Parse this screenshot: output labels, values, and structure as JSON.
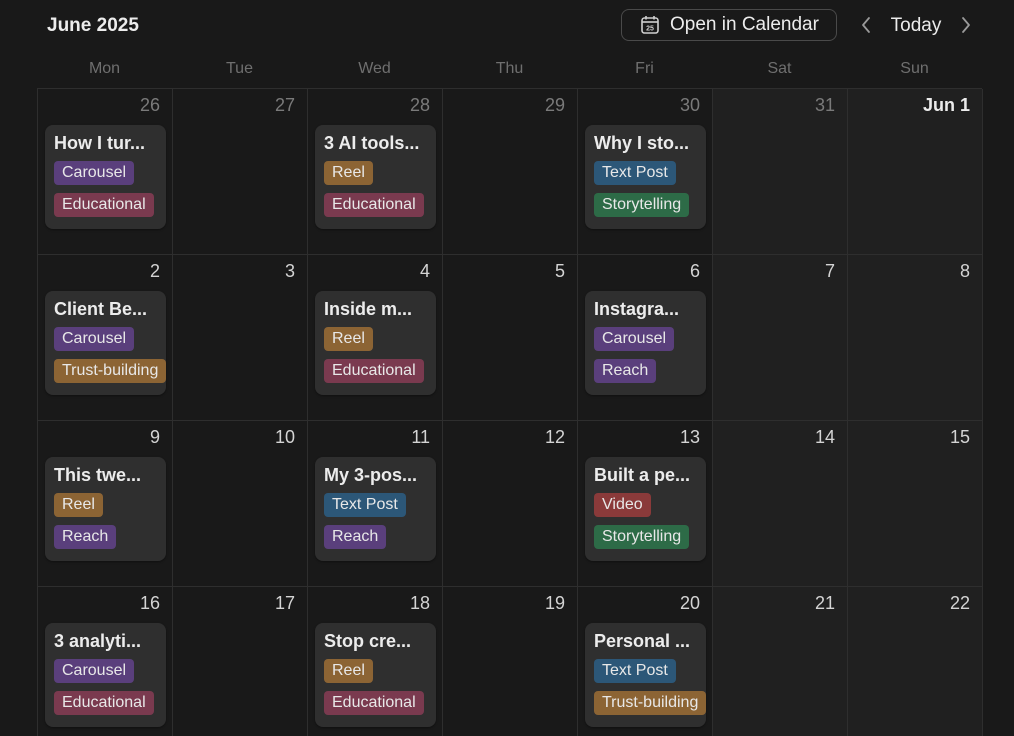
{
  "header": {
    "month_title": "June 2025",
    "open_button_label": "Open in Calendar",
    "open_button_icon": "calendar-icon",
    "open_button_icon_number": "25",
    "today_label": "Today",
    "prev_icon": "chevron-left-icon",
    "next_icon": "chevron-right-icon"
  },
  "weekdays": [
    "Mon",
    "Tue",
    "Wed",
    "Thu",
    "Fri",
    "Sat",
    "Sun"
  ],
  "tag_colors": {
    "Carousel": "#5a3f7c",
    "Educational": "#7a3a4f",
    "Reel": "#8c6434",
    "Text Post": "#2c5778",
    "Storytelling": "#2d6b47",
    "Trust-building": "#8c6434",
    "Reach": "#5a3f7c",
    "Video": "#8a3a3a"
  },
  "weeks": [
    [
      {
        "day": "26",
        "muted": true,
        "post": {
          "title": "How I tur...",
          "tags": [
            "Carousel",
            "Educational"
          ]
        }
      },
      {
        "day": "27",
        "muted": true
      },
      {
        "day": "28",
        "muted": true,
        "post": {
          "title": "3 AI tools...",
          "tags": [
            "Reel",
            "Educational"
          ]
        }
      },
      {
        "day": "29",
        "muted": true
      },
      {
        "day": "30",
        "muted": true,
        "post": {
          "title": "Why I sto...",
          "tags": [
            "Text Post",
            "Storytelling"
          ]
        }
      },
      {
        "day": "31",
        "muted": true
      },
      {
        "day": "Jun 1",
        "month_start": true
      }
    ],
    [
      {
        "day": "2",
        "post": {
          "title": "Client Be...",
          "tags": [
            "Carousel",
            "Trust-building"
          ]
        }
      },
      {
        "day": "3"
      },
      {
        "day": "4",
        "post": {
          "title": "Inside m...",
          "tags": [
            "Reel",
            "Educational"
          ]
        }
      },
      {
        "day": "5"
      },
      {
        "day": "6",
        "post": {
          "title": "Instagra...",
          "tags": [
            "Carousel",
            "Reach"
          ]
        }
      },
      {
        "day": "7"
      },
      {
        "day": "8"
      }
    ],
    [
      {
        "day": "9",
        "post": {
          "title": "This twe...",
          "tags": [
            "Reel",
            "Reach"
          ]
        }
      },
      {
        "day": "10"
      },
      {
        "day": "11",
        "post": {
          "title": "My 3-pos...",
          "tags": [
            "Text Post",
            "Reach"
          ]
        }
      },
      {
        "day": "12"
      },
      {
        "day": "13",
        "post": {
          "title": "Built a pe...",
          "tags": [
            "Video",
            "Storytelling"
          ]
        }
      },
      {
        "day": "14"
      },
      {
        "day": "15"
      }
    ],
    [
      {
        "day": "16",
        "post": {
          "title": "3 analyti...",
          "tags": [
            "Carousel",
            "Educational"
          ]
        }
      },
      {
        "day": "17"
      },
      {
        "day": "18",
        "post": {
          "title": "Stop cre...",
          "tags": [
            "Reel",
            "Educational"
          ]
        }
      },
      {
        "day": "19"
      },
      {
        "day": "20",
        "post": {
          "title": "Personal ...",
          "tags": [
            "Text Post",
            "Trust-building"
          ]
        }
      },
      {
        "day": "21"
      },
      {
        "day": "22"
      }
    ]
  ]
}
